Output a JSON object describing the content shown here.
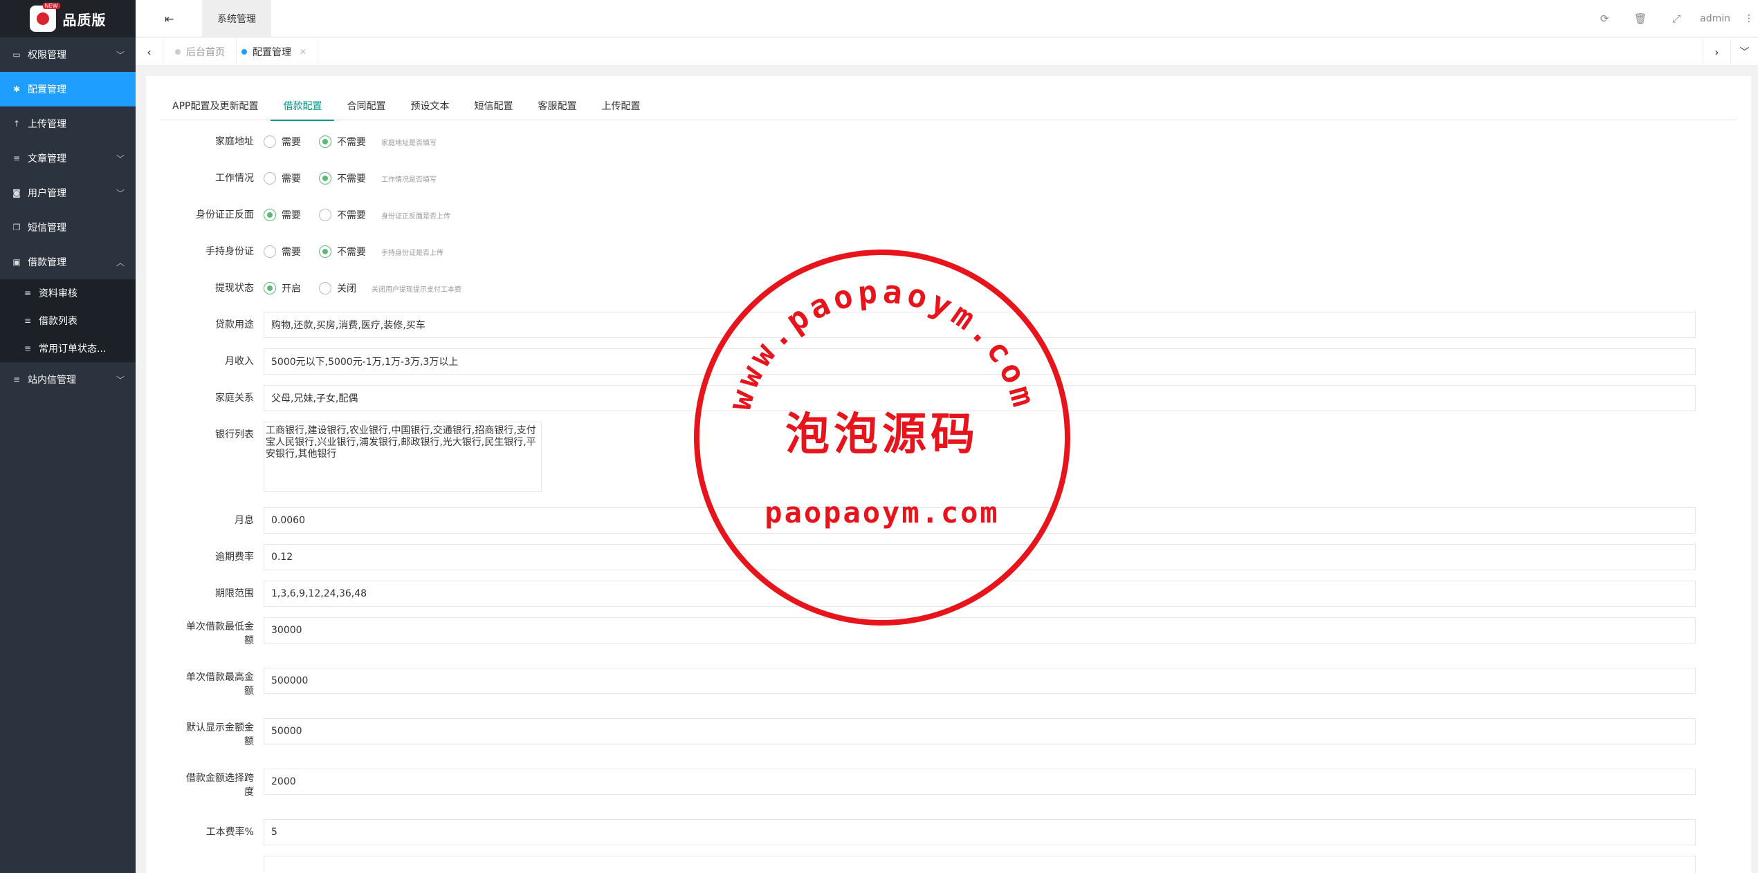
{
  "brand": {
    "name": "品质版",
    "badge": "NEW"
  },
  "sidebar": {
    "items": [
      {
        "label": "权限管理",
        "icon": "laptop-icon",
        "glyph": "▭",
        "chevron": "down"
      },
      {
        "label": "配置管理",
        "icon": "gear-icon",
        "glyph": "✱",
        "active": true
      },
      {
        "label": "上传管理",
        "icon": "upload-icon",
        "glyph": "↑"
      },
      {
        "label": "文章管理",
        "icon": "list-icon",
        "glyph": "≡",
        "chevron": "down"
      },
      {
        "label": "用户管理",
        "icon": "user-icon",
        "glyph": "◙",
        "chevron": "down"
      },
      {
        "label": "短信管理",
        "icon": "copy-icon",
        "glyph": "❐"
      },
      {
        "label": "借款管理",
        "icon": "money-icon",
        "glyph": "▣",
        "chevron": "up"
      },
      {
        "label": "站内信管理",
        "icon": "list-icon",
        "glyph": "≡",
        "chevron": "down"
      }
    ],
    "subitems": [
      {
        "label": "资料审核"
      },
      {
        "label": "借款列表"
      },
      {
        "label": "常用订单状态..."
      }
    ]
  },
  "header": {
    "tab_label": "系统管理",
    "user": "admin",
    "icons": [
      "refresh-icon",
      "trash-icon",
      "fullscreen-icon"
    ]
  },
  "tabsbar": {
    "tabs": [
      {
        "label": "后台首页"
      },
      {
        "label": "配置管理",
        "active": true
      }
    ]
  },
  "config_tabs": [
    {
      "label": "APP配置及更新配置"
    },
    {
      "label": "借款配置",
      "active": true
    },
    {
      "label": "合同配置"
    },
    {
      "label": "预设文本"
    },
    {
      "label": "短信配置"
    },
    {
      "label": "客服配置"
    },
    {
      "label": "上传配置"
    }
  ],
  "form": {
    "radios": [
      {
        "label": "家庭地址",
        "opt1": "需要",
        "opt2": "不需要",
        "selected": 2,
        "hint": "家庭地址是否填写"
      },
      {
        "label": "工作情况",
        "opt1": "需要",
        "opt2": "不需要",
        "selected": 2,
        "hint": "工作情况是否填写"
      },
      {
        "label": "身份证正反面",
        "opt1": "需要",
        "opt2": "不需要",
        "selected": 1,
        "hint": "身份证正反面是否上传"
      },
      {
        "label": "手持身份证",
        "opt1": "需要",
        "opt2": "不需要",
        "selected": 2,
        "hint": "手持身份证是否上传"
      },
      {
        "label": "提现状态",
        "opt1": "开启",
        "opt2": "关闭",
        "selected": 1,
        "hint": "关闭用户提现提示支付工本费"
      }
    ],
    "loan_purpose": {
      "label": "贷款用途",
      "value": "购物,还款,买房,消费,医疗,装修,买车"
    },
    "monthly_income": {
      "label": "月收入",
      "value": "5000元以下,5000元-1万,1万-3万,3万以上"
    },
    "family": {
      "label": "家庭关系",
      "value": "父母,兄妹,子女,配偶"
    },
    "banks": {
      "label": "银行列表",
      "value": "工商银行,建设银行,农业银行,中国银行,交通银行,招商银行,支付宝人民银行,兴业银行,浦发银行,邮政银行,光大银行,民生银行,平安银行,其他银行"
    },
    "monthly_rate": {
      "label": "月息",
      "value": "0.0060"
    },
    "overdue_rate": {
      "label": "逾期费率",
      "value": "0.12"
    },
    "terms": {
      "label": "期限范围",
      "value": "1,3,6,9,12,24,36,48"
    },
    "min_amount": {
      "label1": "单次借款最低金",
      "label2": "额",
      "value": "30000"
    },
    "max_amount": {
      "label1": "单次借款最高金",
      "label2": "额",
      "value": "500000"
    },
    "default_amount": {
      "label1": "默认显示金额金",
      "label2": "额",
      "value": "50000"
    },
    "step": {
      "label1": "借款金额选择跨",
      "label2": "度",
      "value": "2000"
    },
    "fee": {
      "label": "工本费率%",
      "value": "5"
    }
  },
  "watermark": {
    "arc_text": "www.paopaoym.com",
    "center_text": "泡泡源码",
    "bottom_text": "paopaoym.com",
    "color": "#e8141c"
  }
}
